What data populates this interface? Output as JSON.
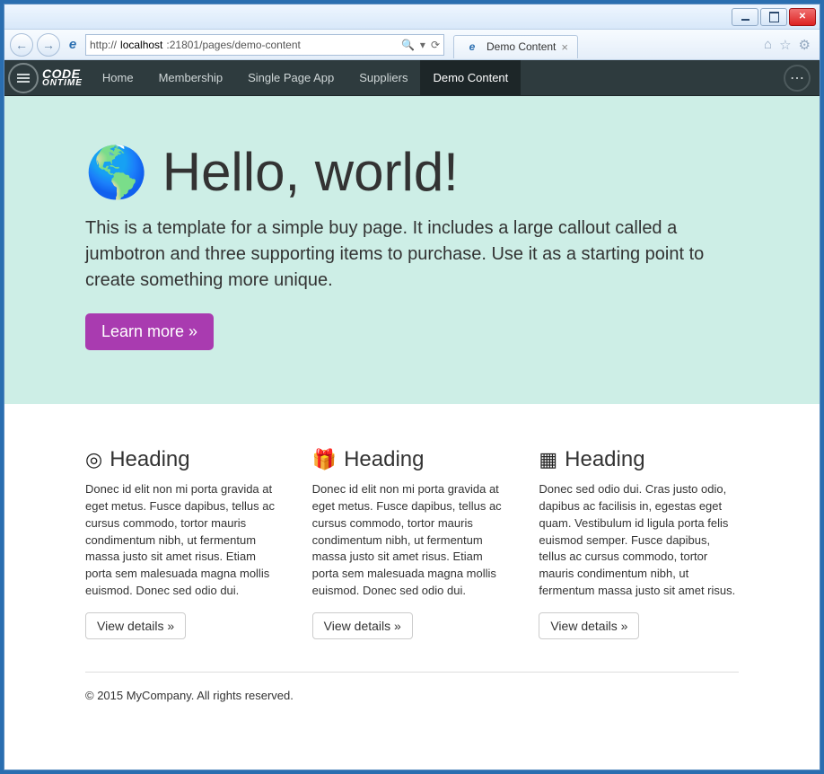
{
  "window": {
    "url_prefix": "http://",
    "url_host": "localhost",
    "url_port_path": ":21801/pages/demo-content",
    "tab_title": "Demo Content"
  },
  "nav": {
    "brand_line1": "CODE",
    "brand_line2": "ONTIME",
    "links": [
      {
        "label": "Home",
        "active": false
      },
      {
        "label": "Membership",
        "active": false
      },
      {
        "label": "Single Page App",
        "active": false
      },
      {
        "label": "Suppliers",
        "active": false
      },
      {
        "label": "Demo Content",
        "active": true
      }
    ]
  },
  "jumbo": {
    "heading": "Hello, world!",
    "paragraph": "This is a template for a simple buy page. It includes a large callout called a jumbotron and three supporting items to purchase. Use it as a starting point to create something more unique.",
    "button": "Learn more »"
  },
  "columns": [
    {
      "icon": "target-icon",
      "glyph": "◎",
      "heading": "Heading",
      "body": "Donec id elit non mi porta gravida at eget metus. Fusce dapibus, tellus ac cursus commodo, tortor mauris condimentum nibh, ut fermentum massa justo sit amet risus. Etiam porta sem malesuada magna mollis euismod. Donec sed odio dui.",
      "button": "View details »"
    },
    {
      "icon": "gift-icon",
      "glyph": "🎁",
      "heading": "Heading",
      "body": "Donec id elit non mi porta gravida at eget metus. Fusce dapibus, tellus ac cursus commodo, tortor mauris condimentum nibh, ut fermentum massa justo sit amet risus. Etiam porta sem malesuada magna mollis euismod. Donec sed odio dui.",
      "button": "View details »"
    },
    {
      "icon": "calendar-icon",
      "glyph": "▦",
      "heading": "Heading",
      "body": "Donec sed odio dui. Cras justo odio, dapibus ac facilisis in, egestas eget quam. Vestibulum id ligula porta felis euismod semper. Fusce dapibus, tellus ac cursus commodo, tortor mauris condimentum nibh, ut fermentum massa justo sit amet risus.",
      "button": "View details »"
    }
  ],
  "footer": "© 2015 MyCompany. All rights reserved."
}
